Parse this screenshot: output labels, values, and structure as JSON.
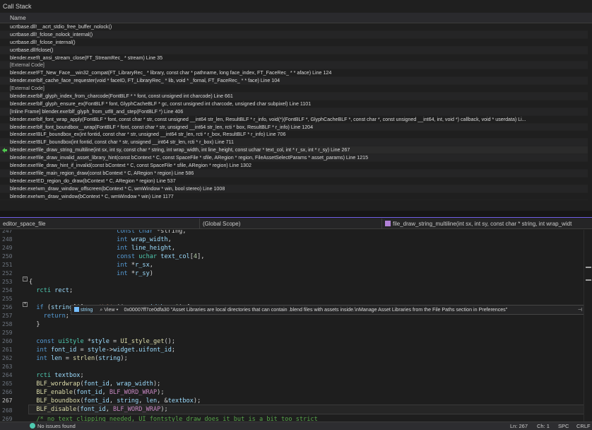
{
  "callstack": {
    "title": "Call Stack",
    "column_name": "Name",
    "frames": [
      {
        "text": "ucrtbase.dll!__acrt_stdio_free_buffer_nolock()",
        "kind": "frame"
      },
      {
        "text": "ucrtbase.dll!_fclose_nolock_internal()",
        "kind": "frame"
      },
      {
        "text": "ucrtbase.dll!_fclose_internal()",
        "kind": "frame"
      },
      {
        "text": "ucrtbase.dll!fclose()",
        "kind": "frame"
      },
      {
        "text": "blender.exe!ft_ansi_stream_close(FT_StreamRec_ * stream) Line 35",
        "kind": "frame"
      },
      {
        "text": "[External Code]",
        "kind": "external"
      },
      {
        "text": "blender.exe!FT_New_Face__win32_compat(FT_LibraryRec_ * library, const char * pathname, long face_index, FT_FaceRec_ * * aface) Line 124",
        "kind": "frame"
      },
      {
        "text": "blender.exe!blf_cache_face_requester(void * faceID, FT_LibraryRec_ * lib, void * _fornal, FT_FaceRec_ * * face) Line 104",
        "kind": "frame"
      },
      {
        "text": "[External Code]",
        "kind": "external"
      },
      {
        "text": "blender.exe!blf_glyph_index_from_charcode(FontBLF * * font, const unsigned int charcode) Line 661",
        "kind": "frame"
      },
      {
        "text": "blender.exe!blf_glyph_ensure_ex(FontBLF * font, GlyphCacheBLF * gc, const unsigned int charcode, unsigned char subpixel) Line 1101",
        "kind": "frame"
      },
      {
        "text": "[Inline Frame] blender.exe!blf_glyph_from_utf8_and_step(FontBLF *) Line 406",
        "kind": "frame"
      },
      {
        "text": "blender.exe!blf_font_wrap_apply(FontBLF * font, const char * str, const unsigned __int64 str_len, ResultBLF * r_info, void(*)(FontBLF *, GlyphCacheBLF *, const char *, const unsigned __int64, int, void *) callback, void * userdata) Li...",
        "kind": "frame"
      },
      {
        "text": "blender.exe!blf_font_boundbox__wrap(FontBLF * font, const char * str, unsigned __int64 str_len, rcti * box, ResultBLF * r_info) Line 1204",
        "kind": "frame"
      },
      {
        "text": "blender.exe!BLF_boundbox_ex(int fontid, const char * str, unsigned __int64 str_len, rcti * r_box, ResultBLF * r_info) Line 706",
        "kind": "frame"
      },
      {
        "text": "blender.exe!BLF_boundbox(int fontid, const char * str, unsigned __int64 str_len, rcti * r_box) Line 711",
        "kind": "frame"
      },
      {
        "text": "blender.exe!file_draw_string_multiline(int sx, int sy, const char * string, int wrap_width, int line_height, const uchar * text_col, int * r_sx, int * r_sy) Line 267",
        "kind": "current"
      },
      {
        "text": "blender.exe!file_draw_invalid_asset_library_hint(const bContext * C, const SpaceFile * sfile, ARegion * region, FileAssetSelectParams * asset_params) Line 1215",
        "kind": "frame"
      },
      {
        "text": "blender.exe!file_draw_hint_if_invalid(const bContext * C, const SpaceFile * sfile, ARegion * region) Line 1302",
        "kind": "frame"
      },
      {
        "text": "blender.exe!file_main_region_draw(const bContext * C, ARegion * region) Line 586",
        "kind": "frame"
      },
      {
        "text": "blender.exe!ED_region_do_draw(bContext * C, ARegion * region) Line 537",
        "kind": "frame"
      },
      {
        "text": "blender.exe!wm_draw_window_offscreen(bContext * C, wmWindow * win, bool stereo) Line 1008",
        "kind": "frame"
      },
      {
        "text": "blender.exe!wm_draw_window(bContext * C, wmWindow * win) Line 1177",
        "kind": "frame"
      }
    ]
  },
  "navbar": {
    "file": "editor_space_file",
    "scope": "(Global Scope)",
    "function": "file_draw_string_multiline(int sx, int sy, const char * string, int wrap_widt"
  },
  "editor": {
    "line_numbers": [
      "247",
      "248",
      "249",
      "250",
      "251",
      "252",
      "253",
      "254",
      "255",
      "256",
      "257",
      "258",
      "259",
      "260",
      "261",
      "262",
      "263",
      "264",
      "265",
      "266",
      "267",
      "268",
      "269"
    ],
    "current_line": "267",
    "datatip": {
      "name": "string",
      "view_label": "View",
      "value": "0x00007ff7ce0dfa30 \"Asset Libraries are local directories that can contain .blend files with assets inside.\\nManage Asset Libraries from the File Paths section in Preferences\""
    }
  },
  "statusbar": {
    "issues": "No issues found",
    "line": "Ln: 267",
    "col": "Ch: 1",
    "spc": "SPC",
    "eol": "CRLF"
  },
  "colors": {
    "accent": "#7160e8",
    "keyword": "#569cd6",
    "type": "#4ec9b0",
    "function": "#dcdcaa",
    "string": "#ce9178",
    "comment": "#57a64a"
  }
}
